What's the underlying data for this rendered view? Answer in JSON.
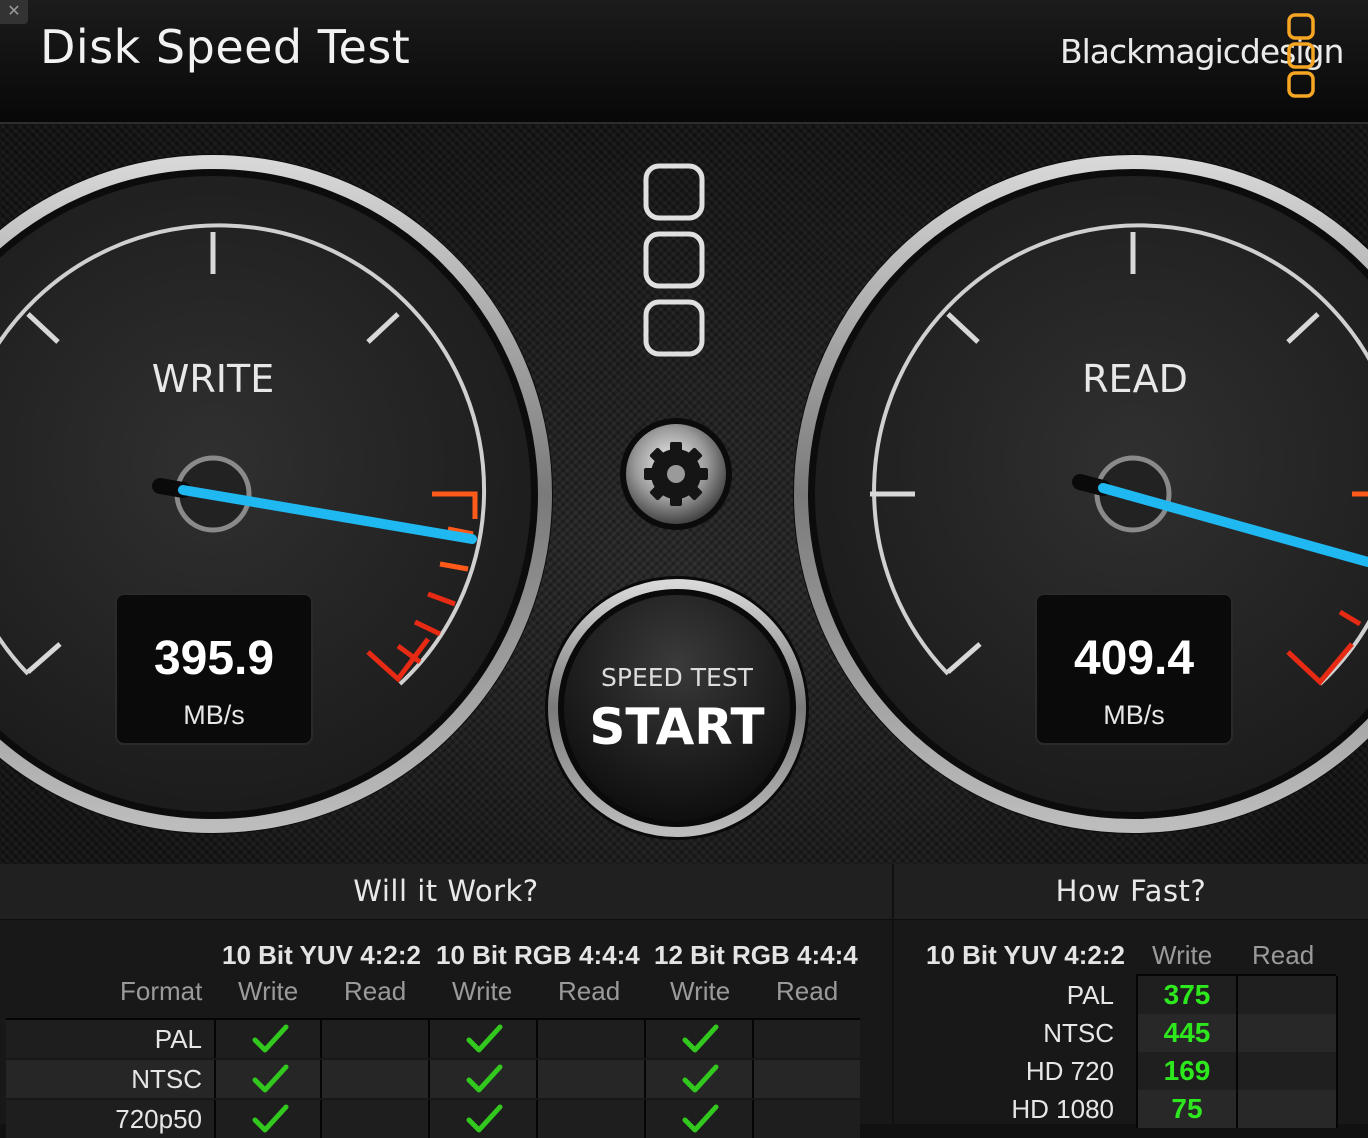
{
  "window": {
    "close_glyph": "✕",
    "title": "Disk Speed Test",
    "brand": "Blackmagicdesign"
  },
  "gauges": {
    "write": {
      "label": "WRITE",
      "value": "395.9",
      "unit": "MB/s"
    },
    "read": {
      "label": "READ",
      "value": "409.4",
      "unit": "MB/s"
    }
  },
  "start_button": {
    "line1": "SPEED TEST",
    "line2": "START"
  },
  "will_it_work": {
    "title": "Will it Work?",
    "format_label": "Format",
    "column_groups": [
      "10 Bit YUV 4:2:2",
      "10 Bit RGB 4:4:4",
      "12 Bit RGB 4:4:4"
    ],
    "sub_columns": [
      "Write",
      "Read",
      "Write",
      "Read",
      "Write",
      "Read"
    ],
    "rows": [
      {
        "format": "PAL",
        "checks": [
          true,
          false,
          true,
          false,
          true,
          false
        ]
      },
      {
        "format": "NTSC",
        "checks": [
          true,
          false,
          true,
          false,
          true,
          false
        ]
      },
      {
        "format": "720p50",
        "checks": [
          true,
          false,
          true,
          false,
          true,
          false
        ]
      }
    ]
  },
  "how_fast": {
    "title": "How Fast?",
    "format_header": "10 Bit YUV 4:2:2",
    "write_label": "Write",
    "read_label": "Read",
    "rows": [
      {
        "format": "PAL",
        "write": "375",
        "read": ""
      },
      {
        "format": "NTSC",
        "write": "445",
        "read": ""
      },
      {
        "format": "HD 720",
        "write": "169",
        "read": ""
      },
      {
        "format": "HD 1080",
        "write": "75",
        "read": ""
      }
    ]
  },
  "colors": {
    "needle": "#1fb8f0",
    "redline": "#e62a14",
    "orangeline": "#ff5a1a",
    "check": "#32c81e",
    "value_green": "#2ee81e",
    "logo_orange": "#f5a623"
  }
}
